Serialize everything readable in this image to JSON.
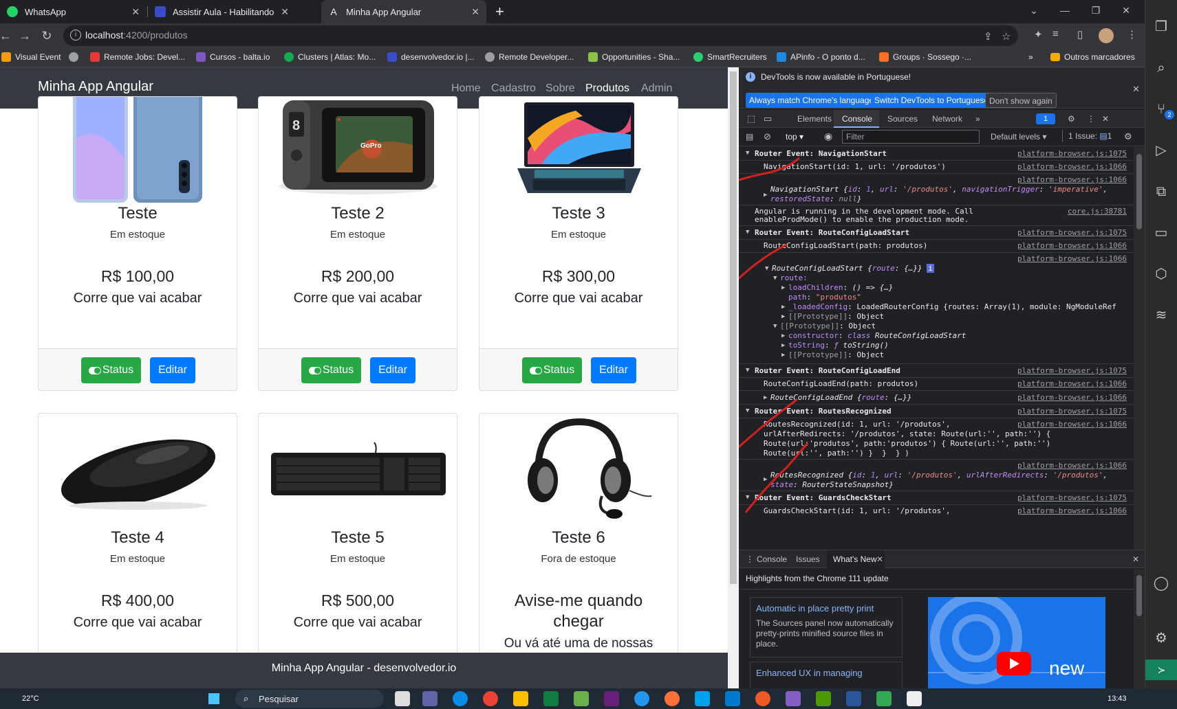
{
  "tabs": [
    {
      "title": "WhatsApp",
      "color": "#25d366",
      "active": false
    },
    {
      "title": "Assistir Aula - Habilitando o Rou",
      "color": "#3b4cca",
      "active": false
    },
    {
      "title": "Minha App Angular",
      "color": "#dd0031",
      "active": true
    }
  ],
  "new_tab_label": "+",
  "address": {
    "host": "localhost",
    "path": ":4200/produtos"
  },
  "bookmarks": [
    {
      "label": "Visual Event",
      "color": "#f39c12"
    },
    {
      "label": "Remote Jobs: Devel...",
      "color": "#e53935"
    },
    {
      "label": "Cursos - balta.io",
      "color": "#7e57c2"
    },
    {
      "label": "Clusters | Atlas: Mo...",
      "color": "#13aa52"
    },
    {
      "label": "desenvolvedor.io |...",
      "color": "#3b4cca"
    },
    {
      "label": "Remote Developer...",
      "color": "#9e9e9e"
    },
    {
      "label": "Opportunities - Sha...",
      "color": "#8bc34a"
    },
    {
      "label": "SmartRecruiters",
      "color": "#2ecc71"
    },
    {
      "label": "APinfo - O ponto d...",
      "color": "#1e88e5"
    },
    {
      "label": "Groups · Sossego ·...",
      "color": "#fc6d26"
    },
    {
      "label": "Outros marcadores",
      "color": "#f9ab00"
    }
  ],
  "app": {
    "brand": "Minha App Angular",
    "nav": [
      "Home",
      "Cadastro",
      "Sobre",
      "Produtos",
      "Admin"
    ],
    "active_nav": "Produtos",
    "footer": "Minha App Angular - desenvolvedor.io"
  },
  "products": [
    {
      "name": "Teste",
      "stock": "Em estoque",
      "price": "R$ 100,00",
      "tag": "Corre que vai acabar",
      "image": "smartphone"
    },
    {
      "name": "Teste 2",
      "stock": "Em estoque",
      "price": "R$ 200,00",
      "tag": "Corre que vai acabar",
      "image": "action-camera"
    },
    {
      "name": "Teste 3",
      "stock": "Em estoque",
      "price": "R$ 300,00",
      "tag": "Corre que vai acabar",
      "image": "laptop"
    },
    {
      "name": "Teste 4",
      "stock": "Em estoque",
      "price": "R$ 400,00",
      "tag": "Corre que vai acabar",
      "image": "mouse"
    },
    {
      "name": "Teste 5",
      "stock": "Em estoque",
      "price": "R$ 500,00",
      "tag": "Corre que vai acabar",
      "image": "keyboard"
    },
    {
      "name": "Teste 6",
      "stock": "Fora de estoque",
      "notify": "Avise-me quando chegar",
      "notify_more": "Ou vá até uma de nossas",
      "image": "headset"
    }
  ],
  "card_buttons": {
    "status": "Status",
    "edit": "Editar"
  },
  "devtools": {
    "notice": "DevTools is now available in Portuguese!",
    "notice_buttons": [
      "Always match Chrome's language",
      "Switch DevTools to Portuguese",
      "Don't show again"
    ],
    "tabs": [
      "Elements",
      "Console",
      "Sources",
      "Network"
    ],
    "active_tab": "Console",
    "issues_badge": "1",
    "context": "top",
    "filter_placeholder": "Filter",
    "levels": "Default levels",
    "issues_count": "1 Issue:",
    "issues_num": "1",
    "drawer_tabs": [
      "Console",
      "Issues",
      "What's New"
    ],
    "whats_new_title": "Highlights from the Chrome 111 update",
    "whats_new_cards": [
      {
        "title": "Automatic in place pretty print",
        "body": "The Sources panel now automatically pretty-prints minified source files in place."
      },
      {
        "title": "Enhanced UX in managing",
        "body": ""
      }
    ],
    "video_label": "new"
  },
  "console_lines": [
    "Router Event: NavigationStart",
    "NavigationStart(id: 1, url: '/produtos')",
    "Angular is running in the development mode. Call",
    "enableProdMode() to enable the production mode.",
    "Router Event: RouteConfigLoadStart",
    "RouteConfigLoadStart(path: produtos)",
    "Router Event: RouteConfigLoadEnd",
    "RouteConfigLoadEnd(path: produtos)",
    "Router Event: RoutesRecognized",
    "RoutesRecognized(id: 1, url: '/produtos',",
    "urlAfterRedirects: '/produtos', state: Route(url:'', path:'') {",
    "Route(url:'produtos', path:'produtos') { Route(url:'', path:'')",
    "Route(url:'', path:'') }  }  } )",
    "Router Event: GuardsCheckStart",
    "GuardsCheckStart(id: 1, url: '/produtos',"
  ],
  "console_sources": {
    "browser_1075": "platform-browser.js:1075",
    "browser_1066": "platform-browser.js:1066",
    "core": "core.js:38781"
  },
  "taskbar": {
    "weather": "22°C",
    "search": "Pesquisar",
    "time": "13:43"
  }
}
